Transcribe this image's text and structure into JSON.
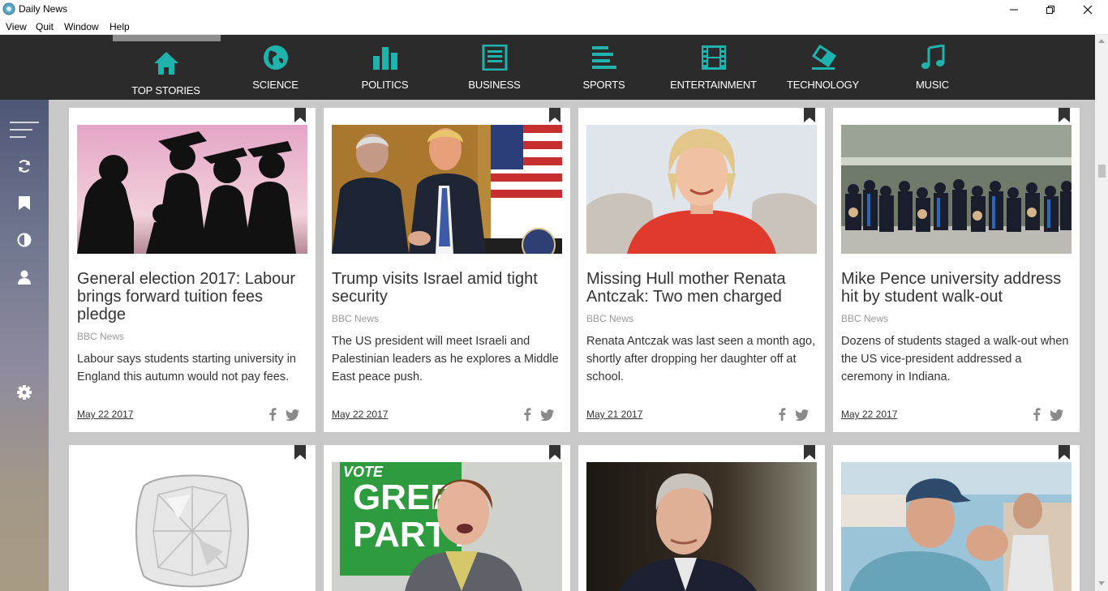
{
  "window": {
    "title": "Daily News",
    "minimize": "—",
    "maximize": "❐",
    "close": "✕"
  },
  "menu": [
    "View",
    "Quit",
    "Window",
    "Help"
  ],
  "nav": [
    {
      "label": "TOP STORIES",
      "icon": "home-icon",
      "active": true
    },
    {
      "label": "SCIENCE",
      "icon": "globe-icon"
    },
    {
      "label": "POLITICS",
      "icon": "bar-chart-icon"
    },
    {
      "label": "BUSINESS",
      "icon": "newspaper-icon"
    },
    {
      "label": "SPORTS",
      "icon": "align-left-icon"
    },
    {
      "label": "ENTERTAINMENT",
      "icon": "film-icon"
    },
    {
      "label": "TECHNOLOGY",
      "icon": "eraser-icon"
    },
    {
      "label": "MUSIC",
      "icon": "music-note-icon"
    }
  ],
  "sidebar": [
    "menu-icon",
    "refresh-icon",
    "bookmark-icon",
    "contrast-icon",
    "user-icon",
    "settings-icon"
  ],
  "colors": {
    "accent": "#1fb3ad",
    "navbar": "#2b2b2b",
    "content_bg": "#c8c8c8"
  },
  "articles": [
    {
      "headline": "General election 2017: Labour brings forward tuition fees pledge",
      "source": "BBC News",
      "summary": "Labour says students starting university in England this autumn would not pay fees.",
      "date": "May 22 2017",
      "image": "graduates-silhouette"
    },
    {
      "headline": "Trump visits Israel amid tight security",
      "source": "BBC News",
      "summary": "The US president will meet Israeli and Palestinian leaders as he explores a Middle East peace push.",
      "date": "May 22 2017",
      "image": "handshake-flags"
    },
    {
      "headline": "Missing Hull mother Renata Antczak: Two men charged",
      "source": "BBC News",
      "summary": "Renata Antczak was last seen a month ago, shortly after dropping her daughter off at school.",
      "date": "May 21 2017",
      "image": "woman-portrait"
    },
    {
      "headline": "Mike Pence university address hit by student walk-out",
      "source": "BBC News",
      "summary": "Dozens of students staged a walk-out when the US vice-president addressed a ceremony in Indiana.",
      "date": "May 22 2017",
      "image": "graduation-crowd"
    },
    {
      "image": "diamond"
    },
    {
      "image": "green-party-sign",
      "sign_top": "VOTE",
      "sign_line1": "GREEN",
      "sign_line2": "PARTY"
    },
    {
      "image": "man-portrait"
    },
    {
      "image": "boy-waving"
    }
  ]
}
